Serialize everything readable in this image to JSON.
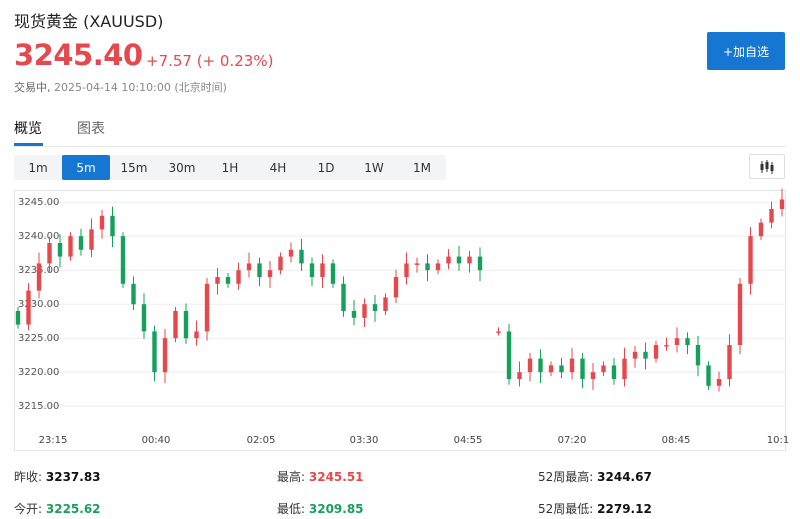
{
  "header": {
    "title": "现货黄金 (XAUUSD)",
    "price": "3245.40",
    "change": "+7.57 (+ 0.23%)",
    "status": "交易中,",
    "timestamp": "2025-04-14 10:10:00 (北京时间)",
    "add_button": "+加自选"
  },
  "tabs": [
    {
      "label": "概览",
      "active": true
    },
    {
      "label": "图表",
      "active": false
    }
  ],
  "periods": [
    {
      "label": "1m",
      "active": false
    },
    {
      "label": "5m",
      "active": true
    },
    {
      "label": "15m",
      "active": false
    },
    {
      "label": "30m",
      "active": false
    },
    {
      "label": "1H",
      "active": false
    },
    {
      "label": "4H",
      "active": false
    },
    {
      "label": "1D",
      "active": false
    },
    {
      "label": "1W",
      "active": false
    },
    {
      "label": "1M",
      "active": false
    }
  ],
  "chart_type_icon": "candlestick-icon",
  "colors": {
    "up": "#e5484d",
    "down": "#17a05d",
    "accent": "#1677d2"
  },
  "chart_data": {
    "type": "candlestick",
    "y_ticks": [
      "3245.00",
      "3240.00",
      "3235.00",
      "3230.00",
      "3225.00",
      "3220.00",
      "3215.00"
    ],
    "ylim": [
      3211.5,
      3246.5
    ],
    "x_ticks": [
      "23:15",
      "00:40",
      "02:05",
      "03:30",
      "04:55",
      "07:20",
      "08:45",
      "10:1"
    ],
    "grid": true,
    "closes": [
      3227,
      3232,
      3236,
      3239,
      3237,
      3240,
      3238,
      3241,
      3243,
      3240,
      3233,
      3230,
      3226,
      3220,
      3225,
      3229,
      3225,
      3226,
      3233,
      3234,
      3233,
      3235,
      3236,
      3234,
      3235,
      3237,
      3238,
      3236,
      3234,
      3236,
      3233,
      3229,
      3228,
      3230,
      3229,
      3231,
      3234,
      3236,
      3236,
      3235,
      3236,
      3237,
      3236,
      3237,
      3235,
      3226,
      3219,
      3220,
      3222,
      3220,
      3221,
      3220,
      3222,
      3219,
      3220,
      3221,
      3219,
      3222,
      3223,
      3222,
      3224,
      3224,
      3225,
      3224,
      3221,
      3218,
      3219,
      3224,
      3233,
      3240,
      3242,
      3244,
      3245.4
    ]
  },
  "stats": [
    {
      "label": "昨收:",
      "value": "3237.83",
      "color": "dark"
    },
    {
      "label": "最高:",
      "value": "3245.51",
      "color": "red"
    },
    {
      "label": "52周最高:",
      "value": "3244.67",
      "color": "dark"
    },
    {
      "label": "今开:",
      "value": "3225.62",
      "color": "green"
    },
    {
      "label": "最低:",
      "value": "3209.85",
      "color": "green"
    },
    {
      "label": "52周最低:",
      "value": "2279.12",
      "color": "dark"
    }
  ]
}
